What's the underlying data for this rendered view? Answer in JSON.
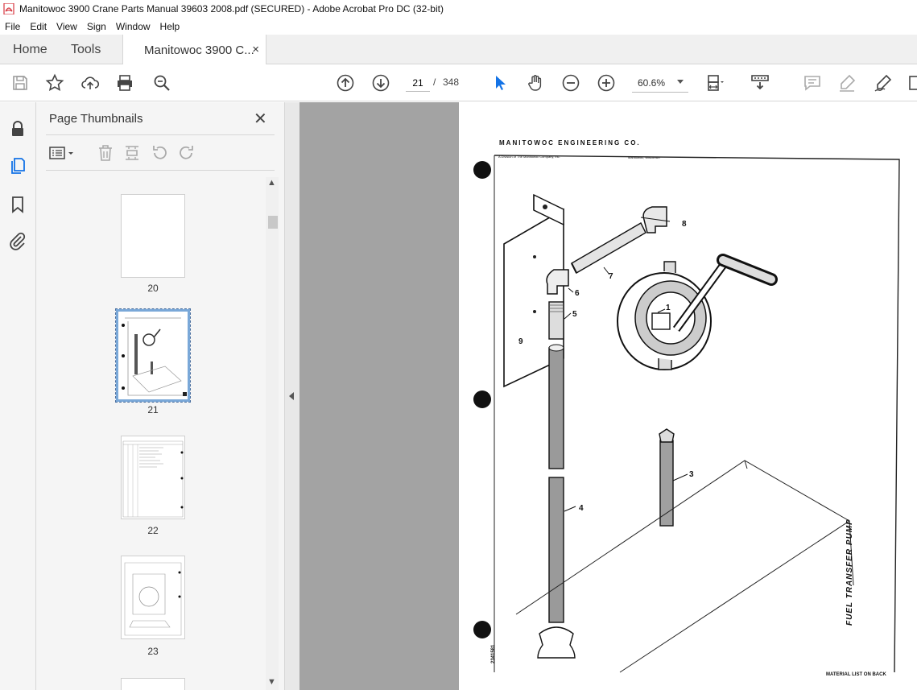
{
  "window": {
    "title": "Manitowoc 3900 Crane Parts Manual 39603 2008.pdf (SECURED) - Adobe Acrobat Pro DC (32-bit)"
  },
  "menu": [
    "File",
    "Edit",
    "View",
    "Sign",
    "Window",
    "Help"
  ],
  "tabs": {
    "home": "Home",
    "tools": "Tools",
    "document": "Manitowoc 3900 C...",
    "close": "×"
  },
  "toolbar": {
    "icons": [
      "save-icon",
      "star-icon",
      "cloud-upload-icon",
      "print-icon",
      "find-icon",
      "prev-page-icon",
      "next-page-icon",
      "select-cursor-icon",
      "hand-icon",
      "zoom-out-icon",
      "zoom-in-icon",
      "fit-page-icon",
      "scroll-mode-icon",
      "comment-icon",
      "highlight-icon",
      "sign-icon"
    ],
    "current_page": "21",
    "page_separator": "/",
    "total_pages": "348",
    "zoom": "60.6%"
  },
  "sidebar": {
    "title": "Page Thumbnails",
    "close": "✕",
    "thumbnails": [
      {
        "label": "20",
        "selected": false
      },
      {
        "label": "21",
        "selected": true
      },
      {
        "label": "22",
        "selected": false
      },
      {
        "label": "23",
        "selected": false
      }
    ]
  },
  "page": {
    "company": "MANITOWOC ENGINEERING CO.",
    "subtitle_left": "A Division of The Manitowoc Company, Inc.",
    "subtitle_right": "Manitowoc, Wisconsin",
    "part_numbers": [
      "1",
      "3",
      "4",
      "5",
      "6",
      "7",
      "8",
      "9"
    ],
    "side_title": "FUEL TRANSFER PUMP",
    "footer": "MATERIAL LIST ON BACK",
    "drawing_number": "2341581"
  },
  "colors": {
    "accent": "#1473e6",
    "pdf_red": "#d7373f",
    "doc_background": "#a3a3a3"
  }
}
